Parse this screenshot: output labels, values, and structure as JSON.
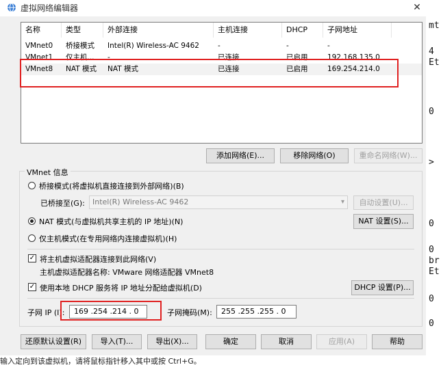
{
  "window": {
    "title": "虚拟网络编辑器",
    "close_glyph": "✕"
  },
  "background_terminal": {
    "lines": [
      "mt",
      "4",
      "Et",
      "0",
      ">",
      "0",
      "0",
      "br",
      "Et",
      "0",
      "0"
    ]
  },
  "network_table": {
    "headers": [
      "名称",
      "类型",
      "外部连接",
      "主机连接",
      "DHCP",
      "子网地址"
    ],
    "rows": [
      [
        "VMnet0",
        "桥接模式",
        "Intel(R) Wireless-AC 9462",
        "-",
        "-",
        "-"
      ],
      [
        "VMnet1",
        "仅主机...",
        "-",
        "已连接",
        "已启用",
        "192.168.135.0"
      ],
      [
        "VMnet8",
        "NAT 模式",
        "NAT 模式",
        "已连接",
        "已启用",
        "169.254.214.0"
      ]
    ],
    "selected_row": 2
  },
  "list_buttons": {
    "add": "添加网络(E)...",
    "remove": "移除网络(O)",
    "rename": "重命名网络(W)..."
  },
  "vmnet_info": {
    "group_title": "VMnet 信息",
    "bridged_label": "桥接模式(将虚拟机直接连接到外部网络)(B)",
    "bridged_to_label": "已桥接至(G):",
    "bridged_to_value": "Intel(R) Wireless-AC 9462",
    "auto_settings": "自动设置(U)...",
    "nat_label": "NAT 模式(与虚拟机共享主机的 IP 地址)(N)",
    "nat_settings": "NAT 设置(S)...",
    "host_only_label": "仅主机模式(在专用网络内连接虚拟机)(H)",
    "connect_adapter_label": "将主机虚拟适配器连接到此网络(V)",
    "adapter_name_label": "主机虚拟适配器名称: VMware 网络适配器 VMnet8",
    "dhcp_label": "使用本地 DHCP 服务将 IP 地址分配给虚拟机(D)",
    "dhcp_settings": "DHCP 设置(P)...",
    "subnet_ip_label": "子网 IP (I):",
    "subnet_ip_value": "169 .254 .214 . 0",
    "subnet_mask_label": "子网掩码(M):",
    "subnet_mask_value": "255 .255 .255 . 0"
  },
  "footer_buttons": {
    "restore_defaults": "还原默认设置(R)",
    "import": "导入(T)...",
    "export": "导出(X)...",
    "ok": "确定",
    "cancel": "取消",
    "apply": "应用(A)",
    "help": "帮助"
  },
  "status_hint": "输入定向到该虚拟机，请将鼠标指针移入其中或按 Ctrl+G。",
  "colors": {
    "highlight_box": "#e02020",
    "selected_row": "#f2f2f2",
    "dialog_bg": "#f0f0f0"
  }
}
